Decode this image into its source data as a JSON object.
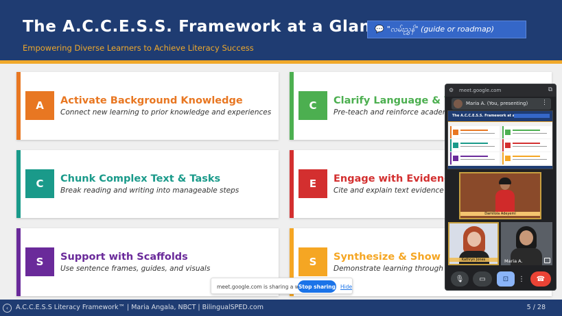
{
  "slide": {
    "title": "The A.C.C.E.S.S. Framework at a Glance",
    "subtitle": "Empowering Diverse Learners to Achieve Literacy Success",
    "translation": "\"လမ်းညွှန်\" (guide or roadmap)",
    "cards": [
      {
        "letter": "A",
        "title": "Activate Background Knowledge",
        "desc": "Connect new learning to prior knowledge and experiences",
        "color": "#e87722"
      },
      {
        "letter": "C",
        "title": "Clarify Language & Voca",
        "desc": "Pre-teach and reinforce academic",
        "color": "#4caf50"
      },
      {
        "letter": "C",
        "title": "Chunk Complex Text & Tasks",
        "desc": "Break reading and writing into manageable steps",
        "color": "#1a9a8a"
      },
      {
        "letter": "E",
        "title": "Engage with Evidence",
        "desc": "Cite and explain text evidence to s",
        "color": "#d32f2f"
      },
      {
        "letter": "S",
        "title": "Support with Scaffolds",
        "desc": "Use sentence frames, guides, and visuals",
        "color": "#6a2a9a"
      },
      {
        "letter": "S",
        "title": "Synthesize & Show Und",
        "desc": "Demonstrate learning through wr",
        "color": "#f5a623"
      }
    ]
  },
  "footer": {
    "text": "A.C.C.E.S.S Literacy Framework™  |  Maria Angala, NBCT  |  BilingualSPED.com",
    "page": "5 / 28",
    "prev_icon": "chevron-left-icon",
    "next_icon": "chevron-right-icon"
  },
  "share_bar": {
    "text": "meet.google.com is sharing a window.",
    "stop_label": "Stop sharing",
    "hide_label": "Hide"
  },
  "meet": {
    "url": "meet.google.com",
    "presenting_label": "Maria A. (You, presenting)",
    "speaker_name": "Damilola Adeyemi",
    "left_participant_caption": "Kathryn Jones",
    "right_participant_name": "Maria A.",
    "mini_slide_title": "The A.C.C.E.S.S. Framework at a Glance",
    "mini_colors": [
      "#e87722",
      "#4caf50",
      "#1a9a8a",
      "#d32f2f",
      "#6a2a9a",
      "#f5a623"
    ]
  },
  "colors": {
    "header_bg": "#1f3c72",
    "accent": "#f0a92b",
    "translate_bg": "#3567c8",
    "meet_bg": "#202124",
    "end_call": "#ea4335"
  }
}
